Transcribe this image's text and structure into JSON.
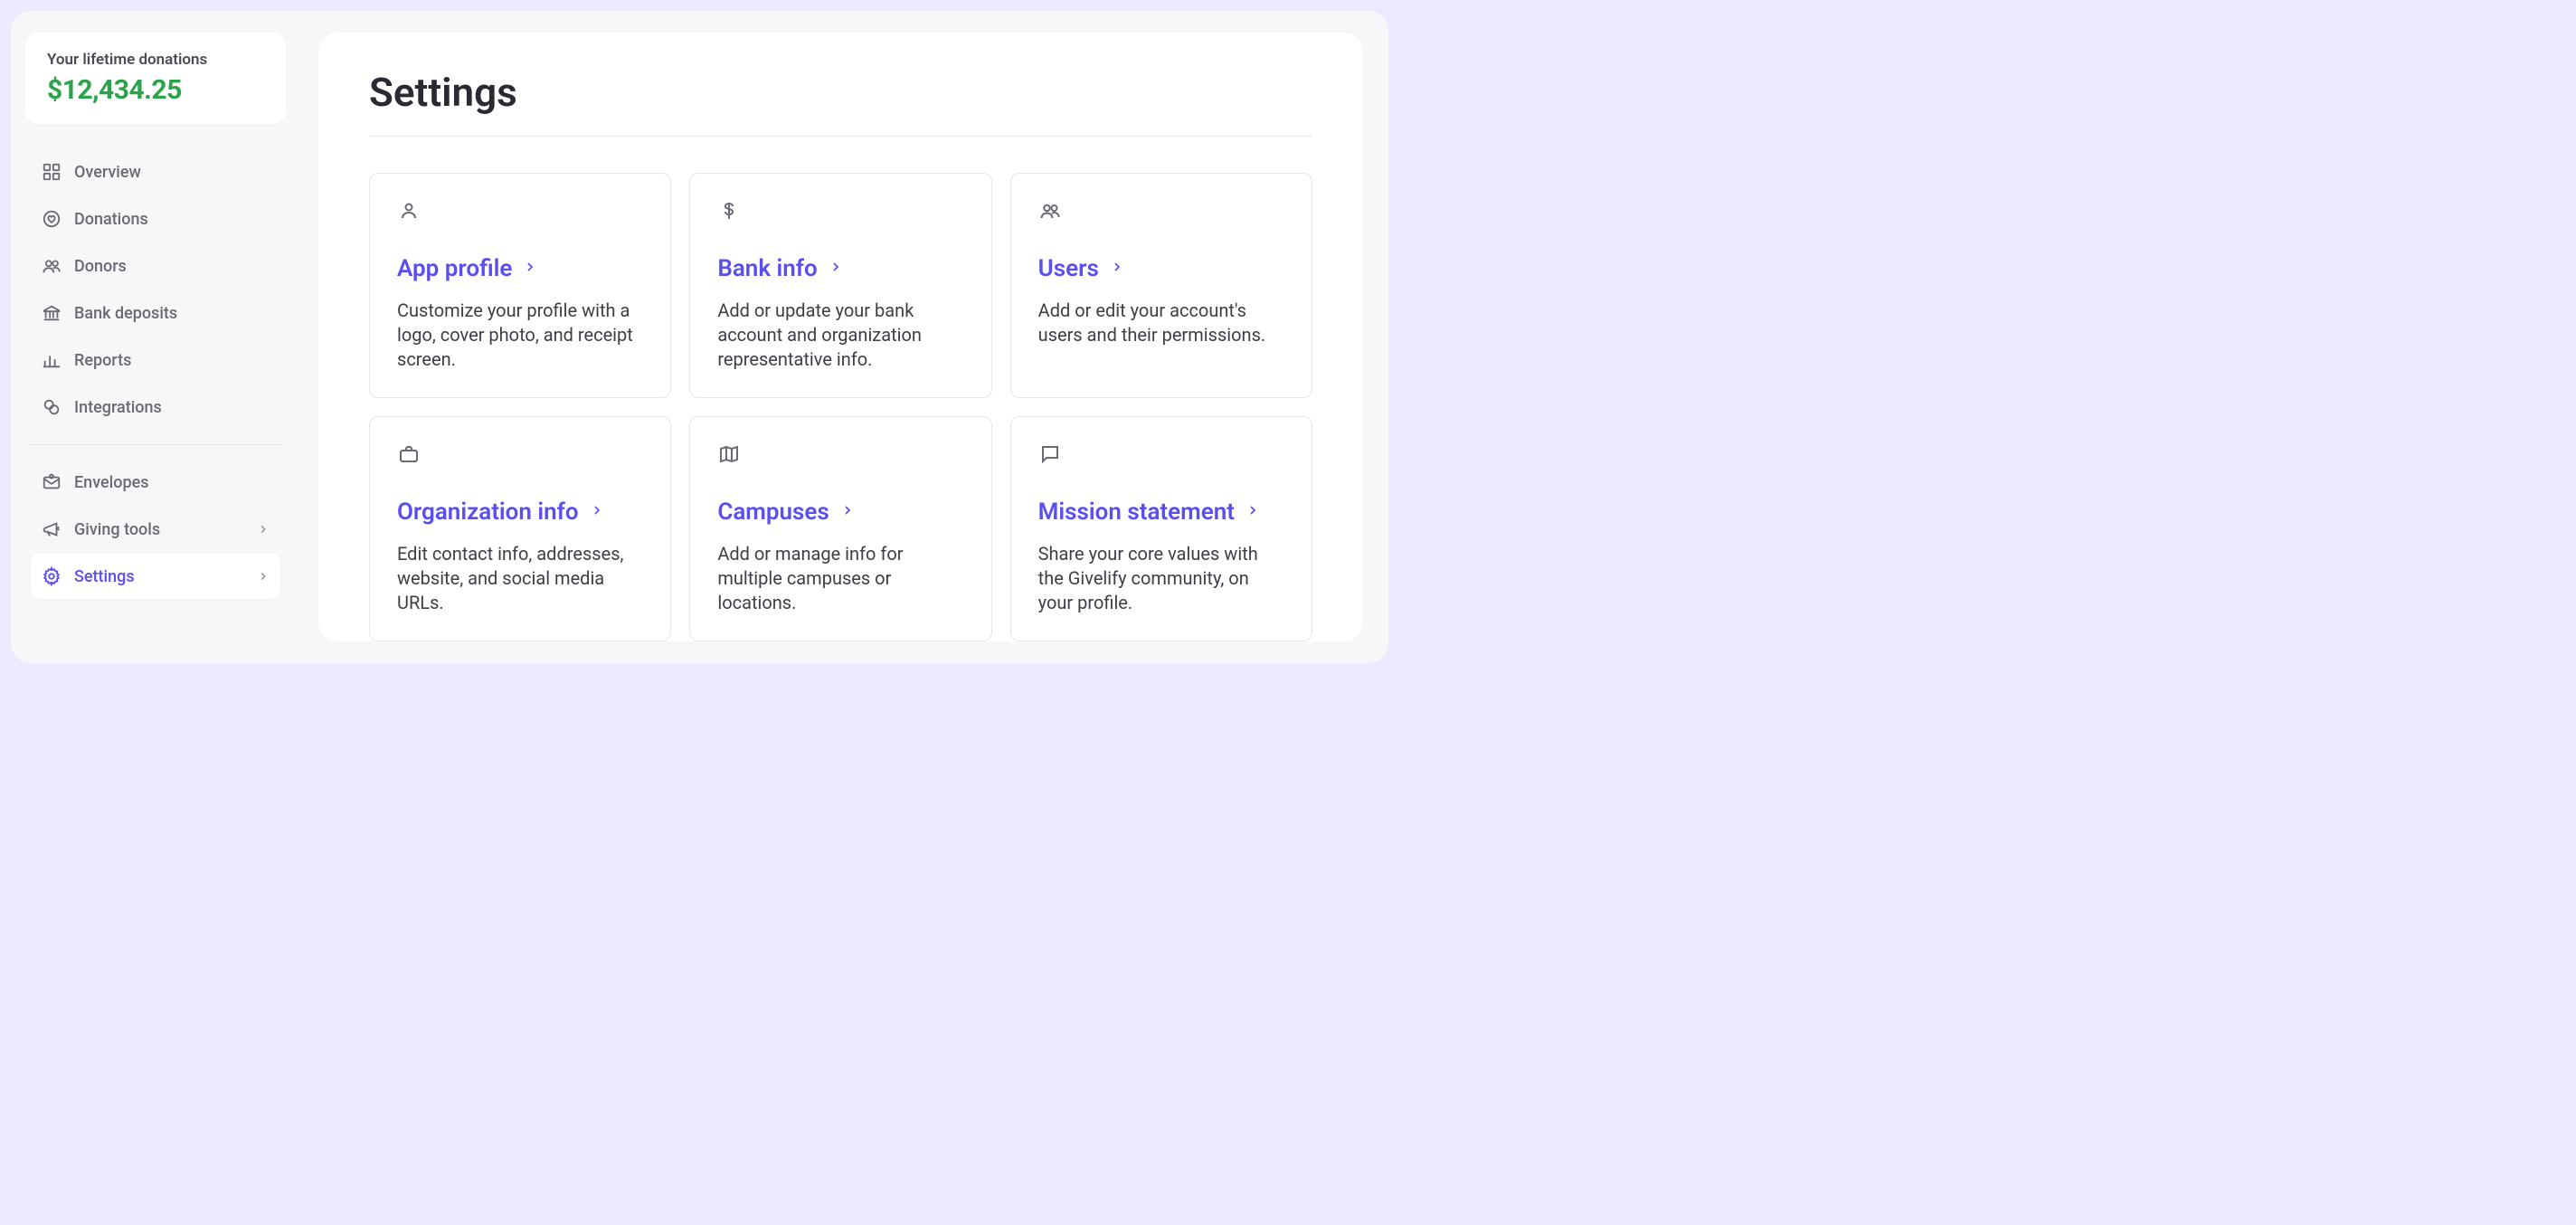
{
  "colors": {
    "accent": "#5a4ef0",
    "positive": "#2ca24b"
  },
  "sidebar": {
    "donation_label": "Your lifetime donations",
    "donation_amount": "$12,434.25",
    "nav": [
      {
        "id": "overview",
        "label": "Overview",
        "icon": "grid"
      },
      {
        "id": "donations",
        "label": "Donations",
        "icon": "heart-circle"
      },
      {
        "id": "donors",
        "label": "Donors",
        "icon": "users"
      },
      {
        "id": "bank-deposits",
        "label": "Bank deposits",
        "icon": "bank"
      },
      {
        "id": "reports",
        "label": "Reports",
        "icon": "bar-chart"
      },
      {
        "id": "integrations",
        "label": "Integrations",
        "icon": "link-circles"
      }
    ],
    "nav2": [
      {
        "id": "envelopes",
        "label": "Envelopes",
        "icon": "envelope"
      },
      {
        "id": "giving-tools",
        "label": "Giving tools",
        "icon": "megaphone",
        "chevron": true
      },
      {
        "id": "settings",
        "label": "Settings",
        "icon": "gear",
        "chevron": true,
        "active": true
      }
    ]
  },
  "page": {
    "title": "Settings",
    "cards": [
      {
        "id": "app-profile",
        "icon": "person",
        "title": "App profile",
        "desc": "Customize your profile with a logo, cover photo, and receipt screen."
      },
      {
        "id": "bank-info",
        "icon": "dollar",
        "title": "Bank info",
        "desc": "Add or update your bank account and organization representative info."
      },
      {
        "id": "users",
        "icon": "users",
        "title": "Users",
        "desc": "Add or edit your account's users and their permissions."
      },
      {
        "id": "organization-info",
        "icon": "briefcase",
        "title": "Organization info",
        "desc": "Edit contact info, addresses, website, and social media URLs."
      },
      {
        "id": "campuses",
        "icon": "map",
        "title": "Campuses",
        "desc": "Add or manage info for multiple campuses or locations."
      },
      {
        "id": "mission-statement",
        "icon": "chat",
        "title": "Mission statement",
        "desc": "Share your core values with the Givelify community, on your profile."
      },
      {
        "id": "help",
        "icon": "help",
        "title": "",
        "desc": ""
      }
    ]
  }
}
